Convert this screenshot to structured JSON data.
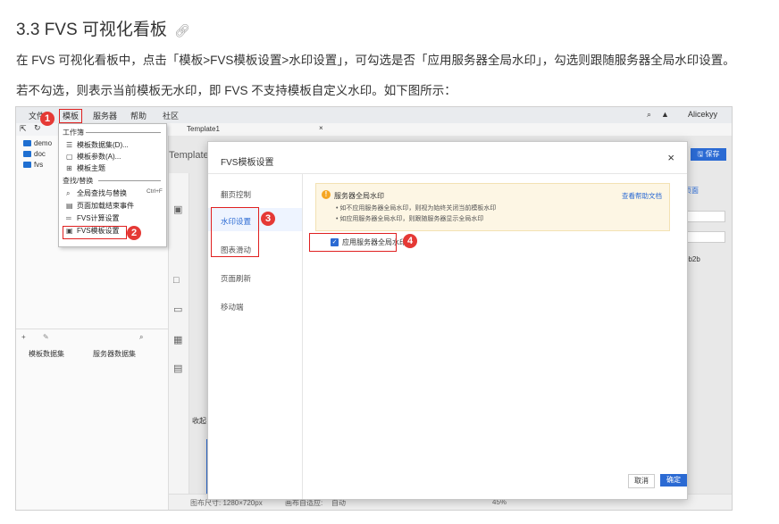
{
  "heading": "3.3 FVS 可视化看板",
  "paragraph1": "在 FVS 可视化看板中，点击「模板>FVS模板设置>水印设置」，可勾选是否「应用服务器全局水印」，勾选则跟随服务器全局水印设置。",
  "paragraph2": "若不勾选，则表示当前模板无水印，即 FVS 不支持模板自定义水印。如下图所示：",
  "screenshot": {
    "menubar": {
      "items": [
        "文件",
        "模板",
        "服务器",
        "帮助",
        "社区"
      ],
      "user": "Alicekyy"
    },
    "tab": "Template1",
    "tree": [
      "demo",
      "doc",
      "fvs"
    ],
    "dropdown": {
      "section1": "工作簿",
      "items1": [
        "模板数据集(D)...",
        "模板参数(A)...",
        "模板主题"
      ],
      "section2": "查找/替换",
      "items2": [
        "全局查找与替换",
        "页面加载结束事件",
        "FVS计算设置",
        "FVS模板设置"
      ],
      "shortcut": "Ctrl+F"
    },
    "left_tabs": [
      "模板数据集",
      "服务器数据集"
    ],
    "canvas_label": "Template",
    "side_label": "收起",
    "dialog": {
      "title": "FVS模板设置",
      "nav": [
        "翻页控制",
        "水印设置",
        "图表滑动",
        "页面刷新",
        "移动端"
      ],
      "notice_title": "服务器全局水印",
      "notice_lines": [
        "如不应用服务器全局水印，则视为始终关闭当前模板水印",
        "如应用服务器全局水印，则跟随服务器显示全局水印"
      ],
      "help_link": "查看帮助文档",
      "checkbox_label": "应用服务器全局水印",
      "cancel": "取消",
      "ok": "确定"
    },
    "right_bits": {
      "save": "保存",
      "page": "页面",
      "color": "0b2b"
    },
    "statusbar": {
      "size": "图布尺寸: 1280×720px",
      "adapt": "画布自适应:",
      "adapt_value": "自动",
      "zoom": "45%"
    },
    "markers": [
      "1",
      "2",
      "3",
      "4"
    ]
  }
}
